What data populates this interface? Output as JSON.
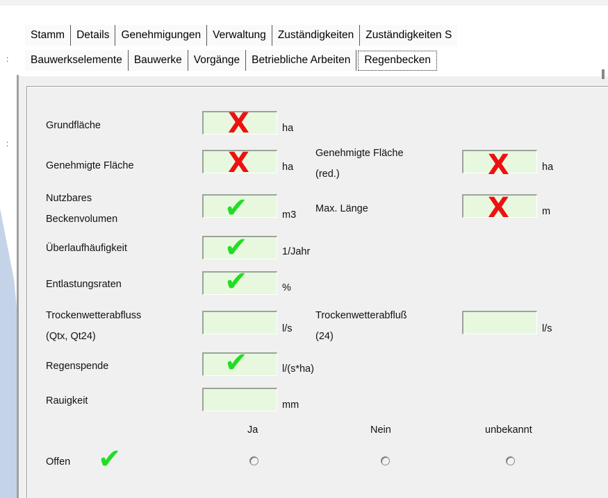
{
  "tabs_row1": [
    "Stamm",
    "Details",
    "Genehmigungen",
    "Verwaltung",
    "Zuständigkeiten",
    "Zuständigkeiten S"
  ],
  "tabs_row2": [
    "Bauwerkselemente",
    "Bauwerke",
    "Vorgänge",
    "Betriebliche Arbeiten",
    "Regenbecken"
  ],
  "active_tab": "Regenbecken",
  "fields": {
    "grundflaeche": {
      "label": "Grundfläche",
      "unit": "ha",
      "mark": "X"
    },
    "genehmigte_flaeche": {
      "label": "Genehmigte Fläche",
      "unit": "ha",
      "mark": "X"
    },
    "genehmigte_flaeche_red": {
      "label_1": "Genehmigte Fläche",
      "label_2": "(red.)",
      "unit": "ha",
      "mark": "X"
    },
    "nutzbares_beckenvolumen": {
      "label_1": "Nutzbares",
      "label_2": "Beckenvolumen",
      "unit": "m3",
      "mark": "✔"
    },
    "max_laenge": {
      "label": "Max. Länge",
      "unit": "m",
      "mark": "X"
    },
    "ueberlaufhaeufigkeit": {
      "label": "Überlaufhäufigkeit",
      "unit": "1/Jahr",
      "mark": "✔"
    },
    "entlastungsraten": {
      "label": "Entlastungsraten",
      "unit": "%",
      "mark": "✔"
    },
    "trockenwetterabfluss": {
      "label_1": "Trockenwetterabfluss",
      "label_2": "(Qtx, Qt24)",
      "unit": "l/s"
    },
    "trockenwetterabfluss_24": {
      "label_1": "Trockenwetterabfluß",
      "label_2": "(24)",
      "unit": "l/s"
    },
    "regenspende": {
      "label": "Regenspende",
      "unit": "l/(s*ha)",
      "mark": "✔"
    },
    "rauigkeit": {
      "label": "Rauigkeit",
      "unit": "mm"
    }
  },
  "offen": {
    "label": "Offen",
    "mark": "✔",
    "options": [
      "Ja",
      "Nein",
      "unbekannt"
    ]
  },
  "colors": {
    "field_bg": "#e7f8df",
    "mark_x": "#ee1111",
    "mark_check": "#22dd22"
  }
}
